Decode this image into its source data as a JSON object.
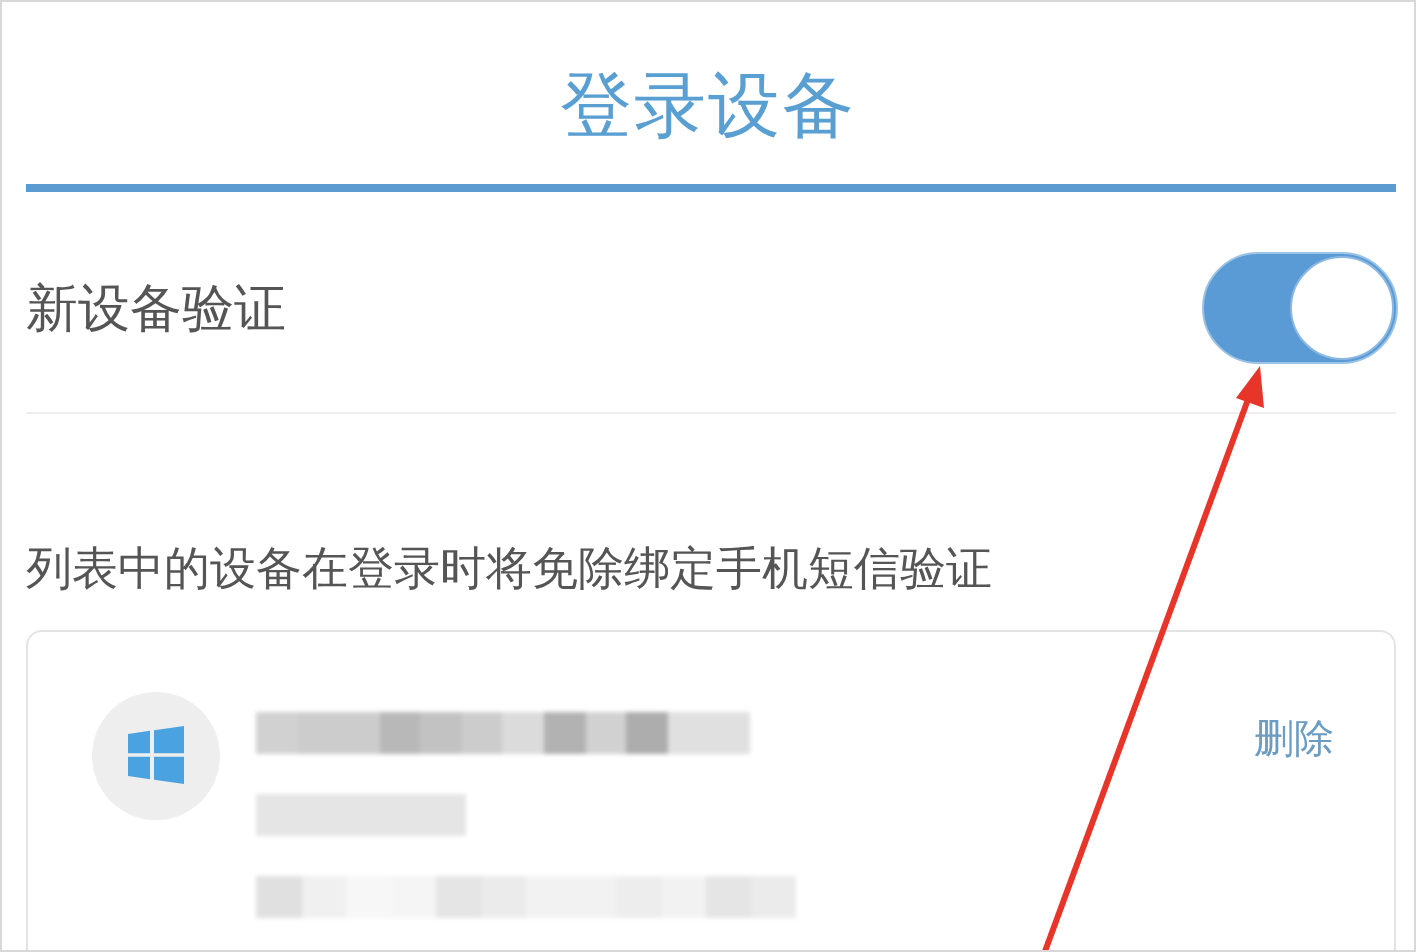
{
  "header": {
    "title": "登录设备"
  },
  "new_device_verification": {
    "label": "新设备验证",
    "on": true
  },
  "description": "列表中的设备在登录时将免除绑定手机短信验证",
  "devices": [
    {
      "kind": "windows",
      "action": "删除"
    }
  ]
}
